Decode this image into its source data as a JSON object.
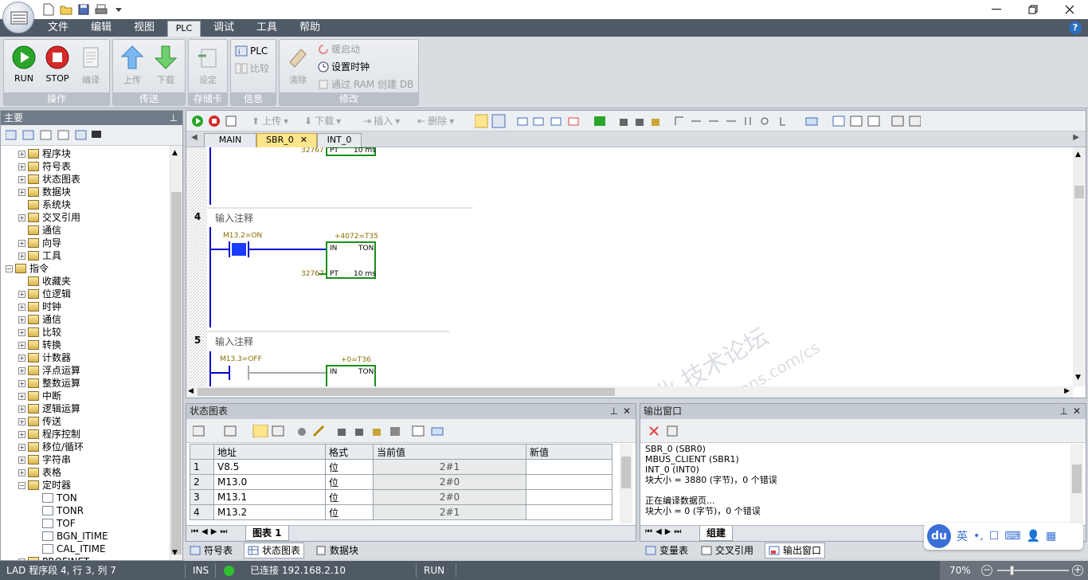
{
  "menu": {
    "items": [
      "文件",
      "编辑",
      "视图",
      "PLC",
      "调试",
      "工具",
      "帮助"
    ],
    "active": "PLC",
    "help_icon": "?"
  },
  "ribbon": {
    "groups": {
      "operation": {
        "label": "操作",
        "run": "RUN",
        "stop": "STOP",
        "compile": "编译"
      },
      "transfer": {
        "label": "传送",
        "upload": "上传",
        "download": "下载"
      },
      "memcard": {
        "label": "存储卡",
        "setup": "设定"
      },
      "info": {
        "label": "信息",
        "plc": "PLC",
        "compare": "比较"
      },
      "modify": {
        "label": "修改",
        "clear": "清除",
        "warm_start": "暖启动",
        "set_clock": "设置时钟",
        "create_db": "通过 RAM 创建 DB"
      }
    }
  },
  "left": {
    "title": "主要",
    "tree": [
      {
        "label": "程序块",
        "level": 1,
        "exp": "+"
      },
      {
        "label": "符号表",
        "level": 1,
        "exp": "+"
      },
      {
        "label": "状态图表",
        "level": 1,
        "exp": "+"
      },
      {
        "label": "数据块",
        "level": 1,
        "exp": "+"
      },
      {
        "label": "系统块",
        "level": 1,
        "exp": ""
      },
      {
        "label": "交叉引用",
        "level": 1,
        "exp": "+"
      },
      {
        "label": "通信",
        "level": 1,
        "exp": ""
      },
      {
        "label": "向导",
        "level": 1,
        "exp": "+"
      },
      {
        "label": "工具",
        "level": 1,
        "exp": "+"
      },
      {
        "label": "指令",
        "level": 0,
        "exp": "-"
      },
      {
        "label": "收藏夹",
        "level": 1,
        "exp": ""
      },
      {
        "label": "位逻辑",
        "level": 1,
        "exp": "+"
      },
      {
        "label": "时钟",
        "level": 1,
        "exp": "+"
      },
      {
        "label": "通信",
        "level": 1,
        "exp": "+"
      },
      {
        "label": "比较",
        "level": 1,
        "exp": "+"
      },
      {
        "label": "转换",
        "level": 1,
        "exp": "+"
      },
      {
        "label": "计数器",
        "level": 1,
        "exp": "+"
      },
      {
        "label": "浮点运算",
        "level": 1,
        "exp": "+"
      },
      {
        "label": "整数运算",
        "level": 1,
        "exp": "+"
      },
      {
        "label": "中断",
        "level": 1,
        "exp": "+"
      },
      {
        "label": "逻辑运算",
        "level": 1,
        "exp": "+"
      },
      {
        "label": "传送",
        "level": 1,
        "exp": "+"
      },
      {
        "label": "程序控制",
        "level": 1,
        "exp": "+"
      },
      {
        "label": "移位/循环",
        "level": 1,
        "exp": "+"
      },
      {
        "label": "字符串",
        "level": 1,
        "exp": "+"
      },
      {
        "label": "表格",
        "level": 1,
        "exp": "+"
      },
      {
        "label": "定时器",
        "level": 1,
        "exp": "-"
      },
      {
        "label": "TON",
        "level": 2,
        "exp": ""
      },
      {
        "label": "TONR",
        "level": 2,
        "exp": ""
      },
      {
        "label": "TOF",
        "level": 2,
        "exp": ""
      },
      {
        "label": "BGN_ITIME",
        "level": 2,
        "exp": ""
      },
      {
        "label": "CAL_ITIME",
        "level": 2,
        "exp": ""
      },
      {
        "label": "PROFINET",
        "level": 1,
        "exp": "+"
      }
    ]
  },
  "editor": {
    "toolbar": {
      "upload": "上传",
      "download": "下载",
      "insert": "插入",
      "delete": "删除"
    },
    "tabs": [
      "MAIN",
      "SBR_0",
      "INT_0"
    ],
    "active_tab": "SBR_0",
    "networks": [
      {
        "num": "4",
        "comment": "输入注释",
        "contact": "M13.2=ON",
        "timer": "+4072=T35",
        "pt": "32767",
        "in": "IN",
        "ton": "TON",
        "ptlbl": "PT",
        "base": "10 ms"
      },
      {
        "num": "5",
        "comment": "输入注释",
        "contact": "M13.3=OFF",
        "timer": "+0=T36",
        "in": "IN",
        "ton": "TON"
      }
    ],
    "prev_network": {
      "pt": "32767",
      "ptlbl": "PT",
      "base": "10 ms"
    },
    "watermark": [
      "西门子工业 技术论坛",
      "support.industry.siemens.com/cs"
    ]
  },
  "status_table": {
    "title": "状态图表",
    "headers": [
      "地址",
      "格式",
      "当前值",
      "新值"
    ],
    "rows": [
      {
        "n": "1",
        "addr": "V8.5",
        "fmt": "位",
        "cur": "2#1",
        "new": ""
      },
      {
        "n": "2",
        "addr": "M13.0",
        "fmt": "位",
        "cur": "2#0",
        "new": ""
      },
      {
        "n": "3",
        "addr": "M13.1",
        "fmt": "位",
        "cur": "2#0",
        "new": ""
      },
      {
        "n": "4",
        "addr": "M13.2",
        "fmt": "位",
        "cur": "2#1",
        "new": ""
      }
    ],
    "sheet_tab": "图表 1"
  },
  "output": {
    "title": "输出窗口",
    "lines": "SBR_0 (SBR0)\nMBUS_CLIENT (SBR1)\nINT_0 (INT0)\n块大小 = 3880 (字节)，0 个错误\n\n正在编译数据页...\n块大小 = 0 (字节)，0 个错误",
    "sheet_tab": "组建"
  },
  "bottom_tabs": {
    "left": [
      "符号表",
      "状态图表",
      "数据块"
    ],
    "left_active": "状态图表",
    "right": [
      "变量表",
      "交叉引用",
      "输出窗口"
    ],
    "right_active": "输出窗口"
  },
  "du": {
    "logo": "du",
    "items": [
      "英",
      "•,",
      "☐",
      "⌨",
      "👤",
      "▦"
    ]
  },
  "status": {
    "position": "LAD 程序段 4, 行 3, 列 7",
    "mode": "INS",
    "connection": "已连接 192.168.2.10",
    "plc_state": "RUN",
    "zoom": "70%"
  },
  "colors": {
    "accent": "#fde58b",
    "run_green": "#2aa52a",
    "stop_red": "#d62828",
    "wire_blue": "#0000cc",
    "contact_on": "#1a3cff"
  }
}
